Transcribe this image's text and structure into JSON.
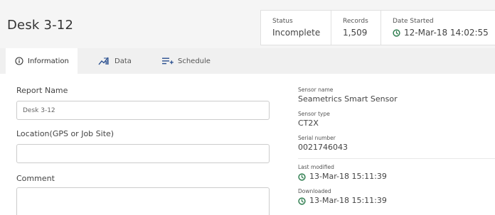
{
  "header": {
    "title": "Desk 3-12",
    "stats": {
      "status_label": "Status",
      "status_value": "Incomplete",
      "records_label": "Records",
      "records_value": "1,509",
      "date_label": "Date Started",
      "date_value": "12-Mar-18 14:02:55",
      "date_icon": "clock-icon"
    }
  },
  "tabs": [
    {
      "label": "Information",
      "icon": "info-icon",
      "active": true
    },
    {
      "label": "Data",
      "icon": "chart-icon",
      "active": false
    },
    {
      "label": "Schedule",
      "icon": "add-list-icon",
      "active": false
    }
  ],
  "form": {
    "report_name": {
      "label": "Report Name",
      "placeholder": "Desk 3-12",
      "value": ""
    },
    "location": {
      "label": "Location(GPS or Job Site)",
      "placeholder": "",
      "value": ""
    },
    "comment": {
      "label": "Comment",
      "placeholder": "",
      "value": ""
    }
  },
  "details": {
    "sensor_name": {
      "label": "Sensor name",
      "value": "Seametrics Smart Sensor"
    },
    "sensor_type": {
      "label": "Sensor type",
      "value": "CT2X"
    },
    "serial_number": {
      "label": "Serial number",
      "value": "0021746043"
    },
    "last_modified": {
      "label": "Last modified",
      "value": "13-Mar-18 15:11:39"
    },
    "downloaded": {
      "label": "Downloaded",
      "value": "13-Mar-18 15:11:39"
    }
  },
  "colors": {
    "clock_accent": "#2e7d4f",
    "header_bg": "#f5f5f5",
    "tabbar_bg": "#f0f0f0"
  }
}
